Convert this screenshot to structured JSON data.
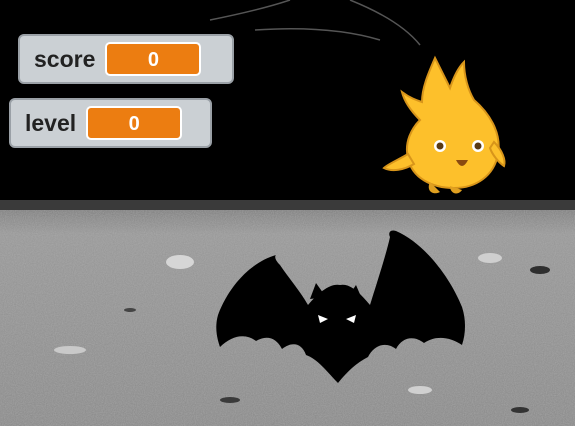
{
  "monitors": {
    "score": {
      "label": "score",
      "value": "0"
    },
    "level": {
      "label": "level",
      "value": "0"
    }
  },
  "sprites": {
    "player": {
      "icon": "fire-sprite-icon",
      "color": "#fdc02b"
    },
    "enemy": {
      "icon": "bat-icon",
      "color": "#000000"
    }
  },
  "colors": {
    "monitor_value_bg": "#ec7d11",
    "monitor_bg": "#cbd0d4",
    "sky": "#000000"
  }
}
